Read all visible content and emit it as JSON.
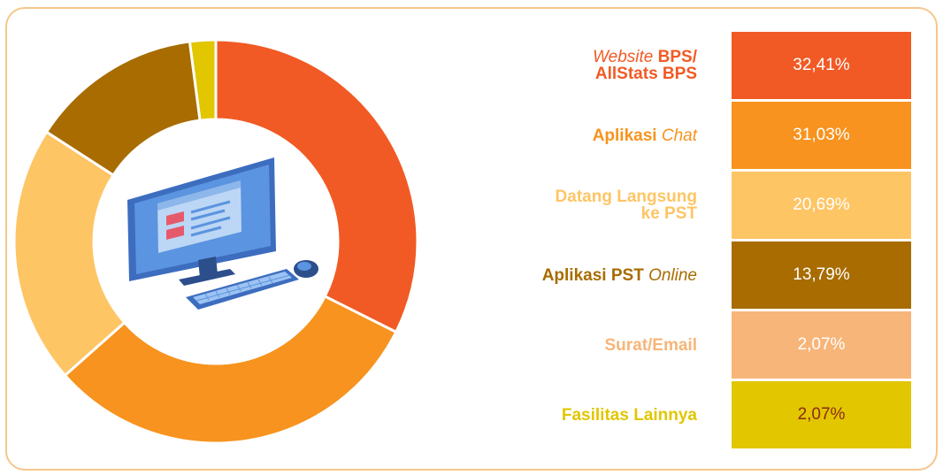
{
  "chart_data": {
    "type": "pie",
    "variant": "donut",
    "slices": [
      {
        "label_parts": [
          {
            "text": "Website",
            "italic": true
          },
          {
            "text": " BPS/",
            "italic": false
          }
        ],
        "label_line2": "AllStats BPS",
        "value_text": "32,41%",
        "value": 32.41,
        "color": "#f15a24",
        "text_color": "#f15a24",
        "value_color": "#ffffff"
      },
      {
        "label_parts": [
          {
            "text": "Aplikasi ",
            "italic": false
          },
          {
            "text": "Chat",
            "italic": true
          }
        ],
        "label_line2": "",
        "value_text": "31,03%",
        "value": 31.03,
        "color": "#f7931e",
        "text_color": "#f7931e",
        "value_color": "#ffffff"
      },
      {
        "label_parts": [
          {
            "text": "Datang Langsung",
            "italic": false
          }
        ],
        "label_line2": "ke PST",
        "value_text": "20,69%",
        "value": 20.69,
        "color": "#fec565",
        "text_color": "#fec565",
        "value_color": "#ffffff"
      },
      {
        "label_parts": [
          {
            "text": "Aplikasi PST ",
            "italic": false
          },
          {
            "text": "Online",
            "italic": true
          }
        ],
        "label_line2": "",
        "value_text": "13,79%",
        "value": 13.79,
        "color": "#a86c00",
        "text_color": "#a86c00",
        "value_color": "#ffffff"
      },
      {
        "label_parts": [
          {
            "text": "Surat/Email",
            "italic": false
          }
        ],
        "label_line2": "",
        "value_text": "2,07%",
        "value": 2.07,
        "color": "#f7b579",
        "text_color": "#f7b579",
        "value_color": "#ffffff"
      },
      {
        "label_parts": [
          {
            "text": "Fasilitas Lainnya",
            "italic": false
          }
        ],
        "label_line2": "",
        "value_text": "2,07%",
        "value": 2.07,
        "color": "#e2c600",
        "text_color": "#e2c600",
        "value_color": "#8b2a14"
      }
    ],
    "donut_visible_order": [
      0,
      1,
      2,
      3,
      5
    ],
    "legend_placement": "right"
  },
  "icons": {
    "center": "computer-illustration-icon"
  },
  "colors": {
    "frame_border": "#f6c68c"
  }
}
